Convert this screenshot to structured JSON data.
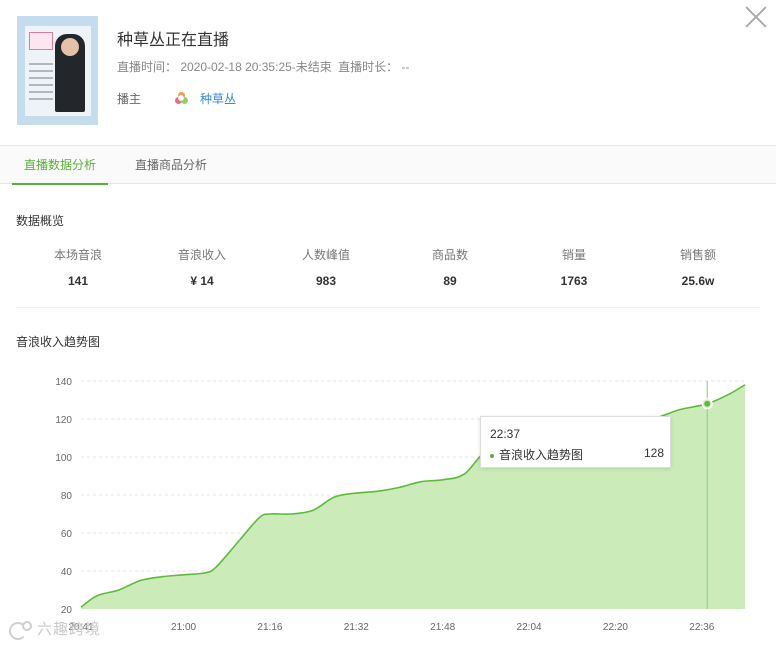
{
  "header": {
    "title": "种草丛正在直播",
    "meta_time_label": "直播时间：",
    "meta_time_value": "2020-02-18 20:35:25-未结束",
    "meta_duration_label": "直播时长：",
    "meta_duration_value": "--",
    "host_label": "播主",
    "host_name": "种草丛"
  },
  "tabs": [
    {
      "label": "直播数据分析",
      "active": true
    },
    {
      "label": "直播商品分析",
      "active": false
    }
  ],
  "overview": {
    "title": "数据概览",
    "stats": [
      {
        "label": "本场音浪",
        "value": "141"
      },
      {
        "label": "音浪收入",
        "value": "¥ 14"
      },
      {
        "label": "人数峰值",
        "value": "983"
      },
      {
        "label": "商品数",
        "value": "89"
      },
      {
        "label": "销量",
        "value": "1763"
      },
      {
        "label": "销售额",
        "value": "25.6w"
      }
    ]
  },
  "trend": {
    "title": "音浪收入趋势图"
  },
  "tooltip": {
    "time": "22:37",
    "series": "音浪收入趋势图",
    "value": "128"
  },
  "watermark": "六趣跨境",
  "colors": {
    "accent": "#58b137",
    "area_fill": "#c8ebb5",
    "line": "#5cbb3a"
  },
  "chart_data": {
    "type": "area",
    "ylim": [
      20,
      140
    ],
    "yticks": [
      20,
      40,
      60,
      80,
      100,
      120,
      140
    ],
    "xticks": [
      "20:41",
      "21:00",
      "21:16",
      "21:32",
      "21:48",
      "22:04",
      "22:20",
      "22:36"
    ],
    "x": [
      "20:41",
      "20:44",
      "20:48",
      "20:52",
      "20:56",
      "21:00",
      "21:04",
      "21:06",
      "21:10",
      "21:14",
      "21:16",
      "21:20",
      "21:24",
      "21:28",
      "21:32",
      "21:36",
      "21:40",
      "21:44",
      "21:48",
      "21:52",
      "21:56",
      "22:00",
      "22:04",
      "22:08",
      "22:12",
      "22:16",
      "22:20",
      "22:24",
      "22:28",
      "22:32",
      "22:37",
      "22:41",
      "22:44"
    ],
    "series": [
      {
        "values": [
          21,
          27,
          30,
          35,
          37,
          38,
          39,
          42,
          55,
          68,
          70,
          70,
          72,
          79,
          81,
          82,
          84,
          87,
          88,
          91,
          103,
          104,
          104,
          107,
          111,
          114,
          115,
          118,
          121,
          125,
          128,
          133,
          138
        ]
      }
    ],
    "highlight_x": "22:37",
    "grid": true
  }
}
